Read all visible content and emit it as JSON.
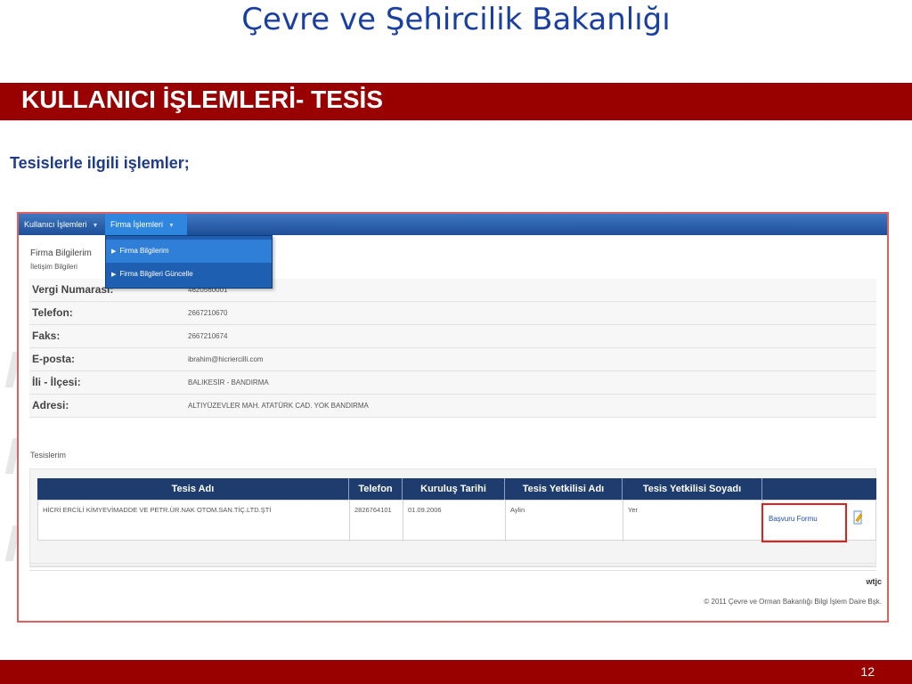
{
  "slide": {
    "title": "Çevre ve Şehircilik Bakanlığı",
    "section_title": "KULLANICI İŞLEMLERİ- TESİS",
    "subtitle": "Tesislerle ilgili işlemler;",
    "page_number": "12"
  },
  "colors": {
    "title_blue": "#1a3fa3",
    "band_red": "#990000",
    "nav_blue": "#1d4f98",
    "table_header": "#1e3d6e",
    "highlight_red": "#e02020"
  },
  "app": {
    "nav": {
      "items": [
        {
          "label": "Kullanıcı İşlemleri",
          "icon": "caret-down-icon"
        },
        {
          "label": "Firma İşlemleri",
          "icon": "caret-down-icon",
          "active": true
        }
      ],
      "dropdown": [
        {
          "label": "Firma Bilgilerim",
          "icon": "triangle-right-icon"
        },
        {
          "label": "Firma Bilgileri Güncelle",
          "icon": "triangle-right-icon"
        }
      ]
    },
    "firm": {
      "heading": "Firma Bilgilerim",
      "subheading": "İletişim Bilgileri",
      "rows": [
        {
          "label": "Vergi Numarası:",
          "value": "4620560001"
        },
        {
          "label": "Telefon:",
          "value": "2667210670"
        },
        {
          "label": "Faks:",
          "value": "2667210674"
        },
        {
          "label": "E-posta:",
          "value": "ibrahim@hicriercilli.com"
        },
        {
          "label": "İli - İlçesi:",
          "value": "BALIKESİR - BANDIRMA"
        },
        {
          "label": "Adresi:",
          "value": "ALTIYÜZEVLER MAH. ATATÜRK CAD. YOK BANDIRMA"
        }
      ]
    },
    "facilities": {
      "heading": "Tesislerim",
      "columns": [
        "Tesis Adı",
        "Telefon",
        "Kuruluş Tarihi",
        "Tesis Yetkilisi Adı",
        "Tesis Yetkilisi Soyadı",
        ""
      ],
      "rows": [
        {
          "name": "HİCRİ ERCİLİ KİMYEVİMADDE VE PETR.ÜR.NAK OTOM.SAN.TİÇ.LTD.ŞTİ",
          "phone": "2826764101",
          "founded": "01.09.2006",
          "contact_first": "Aylin",
          "contact_last": "Yer",
          "action": "Başvuru Formu",
          "action_icon": "form-edit-icon"
        }
      ]
    },
    "footer": {
      "brand": "wtjc",
      "copyright": "© 2011 Çevre ve Orman Bakanlığı Bilgi İşlem Daire Bşk."
    }
  }
}
